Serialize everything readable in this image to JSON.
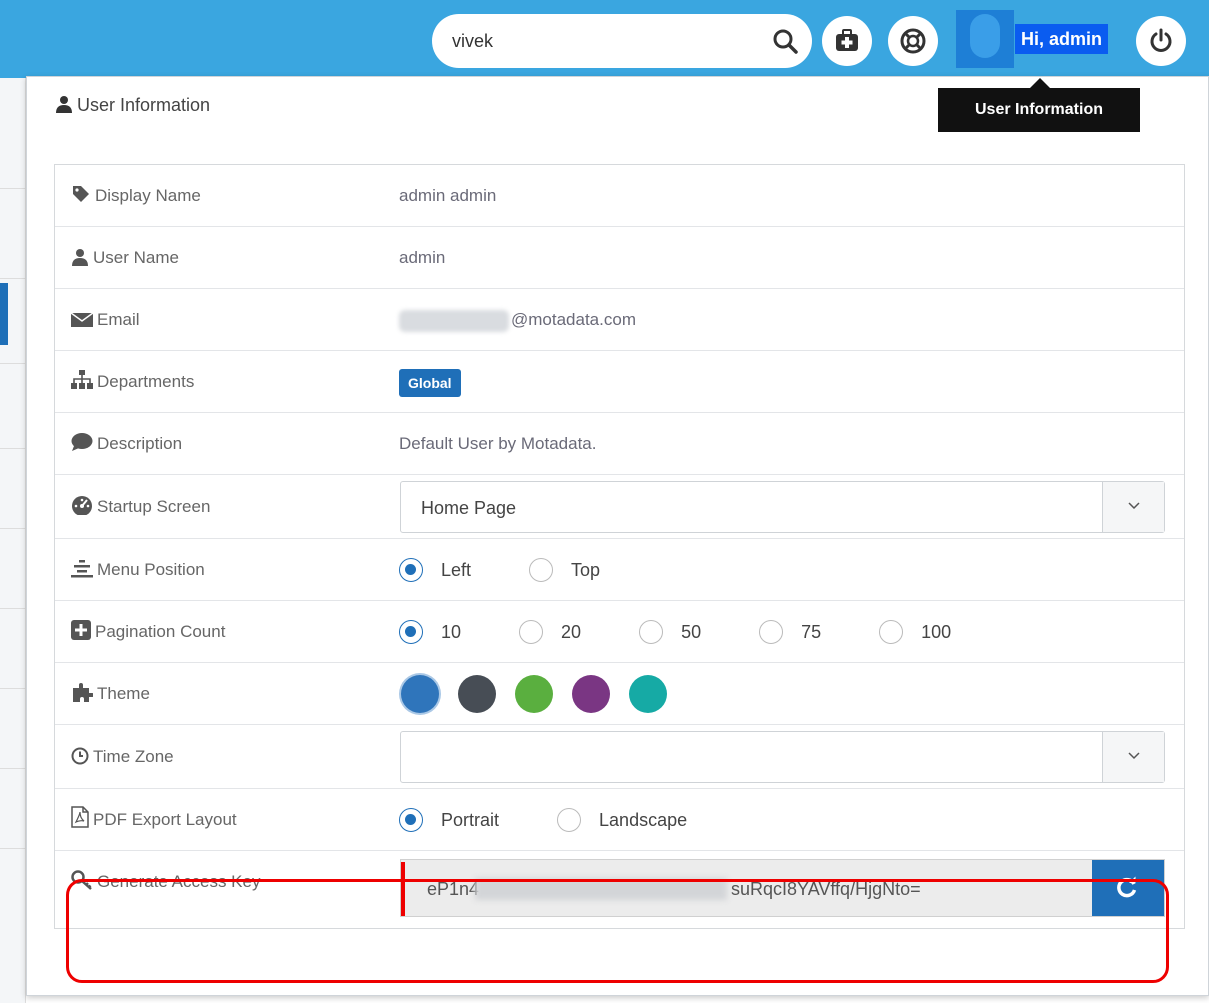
{
  "header": {
    "search_value": "vivek",
    "greeting": "Hi, admin",
    "tooltip": "User Information",
    "icons": [
      "search-icon",
      "medical-kit-icon",
      "life-ring-icon",
      "avatar",
      "power-icon"
    ]
  },
  "panel": {
    "title": "User Information",
    "rows": {
      "display_name": {
        "label": "Display Name",
        "value": "admin admin"
      },
      "user_name": {
        "label": "User Name",
        "value": "admin"
      },
      "email": {
        "label": "Email",
        "value": "@motadata.com"
      },
      "departments": {
        "label": "Departments",
        "value": "Global"
      },
      "description": {
        "label": "Description",
        "value": "Default User by Motadata."
      },
      "startup_screen": {
        "label": "Startup Screen",
        "value": "Home Page"
      },
      "menu_position": {
        "label": "Menu Position",
        "options": [
          "Left",
          "Top"
        ],
        "selected": "Left"
      },
      "pagination_count": {
        "label": "Pagination Count",
        "options": [
          "10",
          "20",
          "50",
          "75",
          "100"
        ],
        "selected": "10"
      },
      "theme": {
        "label": "Theme",
        "colors": [
          "#2f75bb",
          "#474d55",
          "#5aaf3f",
          "#7a3683",
          "#16aaa5"
        ],
        "selected": "#2f75bb"
      },
      "time_zone": {
        "label": "Time Zone",
        "value": ""
      },
      "pdf_export_layout": {
        "label": "PDF Export Layout",
        "options": [
          "Portrait",
          "Landscape"
        ],
        "selected": "Portrait"
      },
      "access_key": {
        "label": "Generate Access Key",
        "prefix": "eP1n4",
        "suffix": "suRqcI8YAVffq/HjgNto="
      }
    }
  },
  "colors": {
    "topbar": "#3aa6e0",
    "accent": "#1f6fb8",
    "highlight": "#ee0000"
  }
}
